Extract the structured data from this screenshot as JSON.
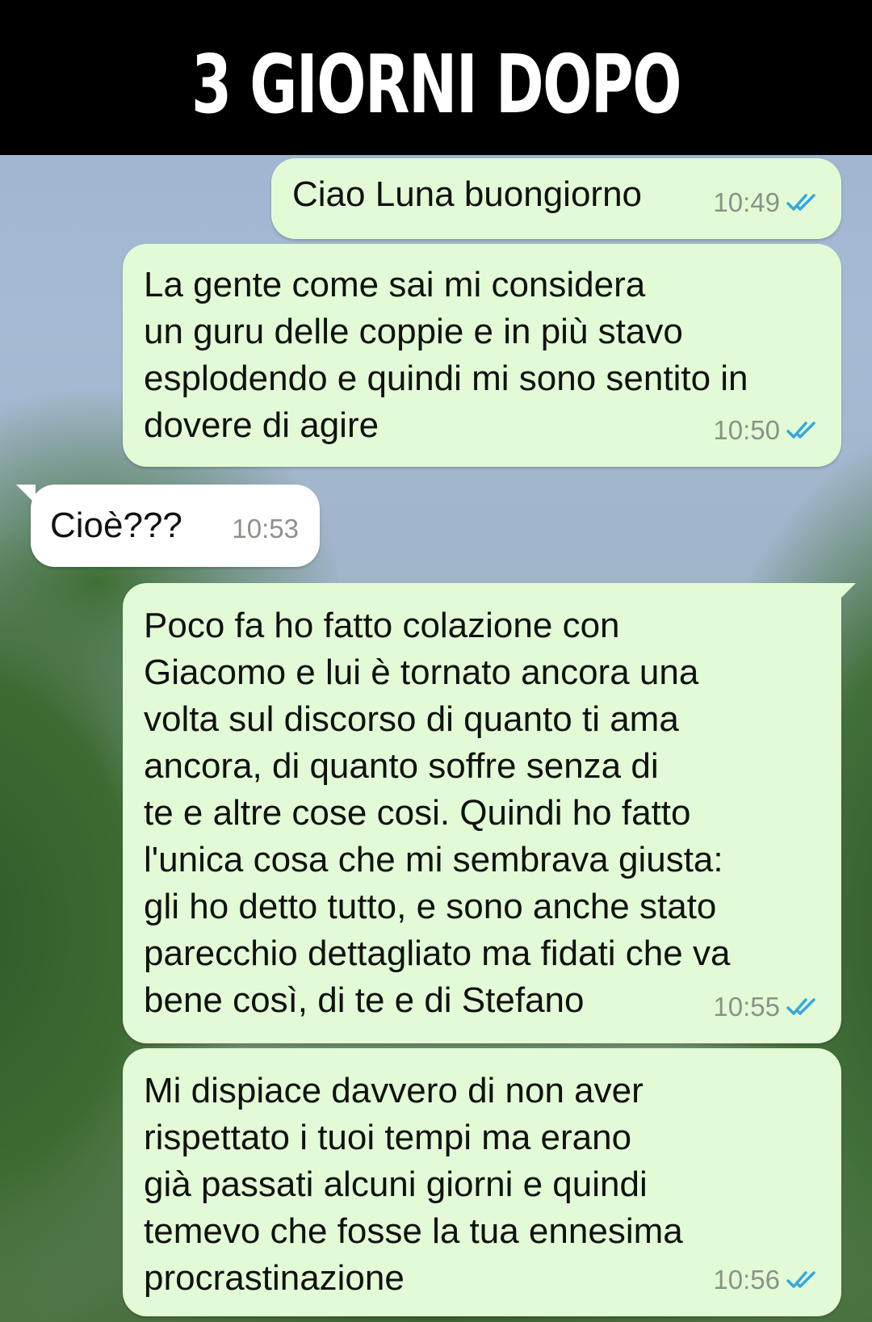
{
  "banner": {
    "title": "3 GIORNI DOPO"
  },
  "messages": [
    {
      "text": "Ciao Luna buongiorno",
      "time": "10:49"
    },
    {
      "text": "La gente come sai mi considera\nun guru delle coppie e in più stavo\nesplodendo e quindi mi sono sentito in\ndovere di agire",
      "time": "10:50"
    },
    {
      "text": "Cioè???",
      "time": "10:53"
    },
    {
      "text": "Poco fa ho fatto colazione con\nGiacomo e lui è tornato ancora una\nvolta sul discorso di quanto ti ama\nancora, di quanto soffre senza di\nte e altre cose cosi. Quindi ho fatto\nl'unica cosa che mi sembrava giusta:\ngli ho detto tutto, e sono anche stato\nparecchio dettagliato ma fidati che va\nbene così, di te e di Stefano",
      "time": "10:55"
    },
    {
      "text": "Mi dispiace davvero di non aver\nrispettato i tuoi tempi ma erano\ngià passati alcuni giorni e quindi\ntemevo che fosse la tua ennesima\nprocrastinazione",
      "time": "10:56"
    }
  ],
  "colors": {
    "outgoing_bubble": "#e2fbd6",
    "incoming_bubble": "#ffffff",
    "read_ticks": "#34a7e0",
    "banner": "#000000"
  },
  "icons": {
    "read_receipt": "double-check-icon"
  }
}
